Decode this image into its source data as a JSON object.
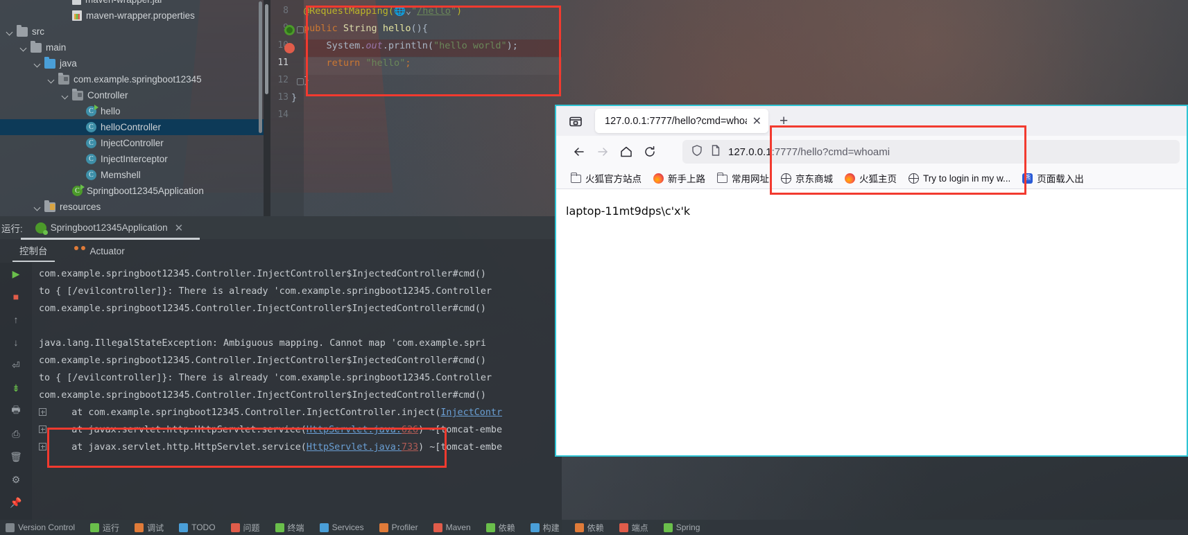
{
  "ide": {
    "project_tree": [
      {
        "label": "maven-wrapper.jar",
        "indent": 4,
        "icon": "jar-icon",
        "chevron": false,
        "selected": false
      },
      {
        "label": "maven-wrapper.properties",
        "indent": 4,
        "icon": "properties-icon",
        "chevron": false,
        "selected": false
      },
      {
        "label": "src",
        "indent": 0,
        "icon": "folder-icon",
        "chevron": true,
        "selected": false
      },
      {
        "label": "main",
        "indent": 1,
        "icon": "folder-icon",
        "chevron": true,
        "selected": false
      },
      {
        "label": "java",
        "indent": 2,
        "icon": "folder-blue-icon",
        "chevron": true,
        "selected": false
      },
      {
        "label": "com.example.springboot12345",
        "indent": 3,
        "icon": "package-icon",
        "chevron": true,
        "selected": false
      },
      {
        "label": "Controller",
        "indent": 4,
        "icon": "package-icon",
        "chevron": true,
        "selected": false
      },
      {
        "label": "hello",
        "indent": 5,
        "icon": "class-runnable-icon",
        "chevron": false,
        "selected": false
      },
      {
        "label": "helloController",
        "indent": 5,
        "icon": "class-icon",
        "chevron": false,
        "selected": true
      },
      {
        "label": "InjectController",
        "indent": 5,
        "icon": "class-icon",
        "chevron": false,
        "selected": false
      },
      {
        "label": "InjectInterceptor",
        "indent": 5,
        "icon": "class-icon",
        "chevron": false,
        "selected": false
      },
      {
        "label": "Memshell",
        "indent": 5,
        "icon": "class-icon",
        "chevron": false,
        "selected": false
      },
      {
        "label": "Springboot12345Application",
        "indent": 4,
        "icon": "spring-class-icon",
        "chevron": false,
        "selected": false
      },
      {
        "label": "resources",
        "indent": 2,
        "icon": "folder-resources-icon",
        "chevron": true,
        "selected": false
      }
    ],
    "editor": {
      "lines": [
        {
          "num": "8",
          "code": "@RequestMapping(\"/hello\")",
          "marker": "",
          "current": false,
          "highlight": false
        },
        {
          "num": "9",
          "code": "public String hello(){",
          "marker": "spring-bean-icon",
          "current": false,
          "highlight": false
        },
        {
          "num": "10",
          "code": "    System.out.println(\"hello world\");",
          "marker": "breakpoint-icon",
          "current": false,
          "highlight": true
        },
        {
          "num": "11",
          "code": "    return \"hello\";",
          "marker": "",
          "current": true,
          "highlight": false
        },
        {
          "num": "12",
          "code": "}",
          "marker": "",
          "current": false,
          "highlight": false
        },
        {
          "num": "13",
          "code": "}",
          "marker": "",
          "current": false,
          "highlight": false
        },
        {
          "num": "14",
          "code": "",
          "marker": "",
          "current": false,
          "highlight": false
        }
      ]
    },
    "run_panel": {
      "run_label": "运行:",
      "config_name": "Springboot12345Application",
      "tabs": [
        {
          "label": "控制台",
          "active": true
        },
        {
          "label": "Actuator",
          "active": false
        }
      ],
      "console_lines": [
        "com.example.springboot12345.Controller.InjectController$InjectedController#cmd()",
        "to { [/evilcontroller]}: There is already 'com.example.springboot12345.Controller",
        "com.example.springboot12345.Controller.InjectController$InjectedController#cmd()",
        "",
        "java.lang.IllegalStateException: Ambiguous mapping. Cannot map 'com.example.spri",
        "com.example.springboot12345.Controller.InjectController$InjectedController#cmd()",
        "to { [/evilcontroller]}: There is already 'com.example.springboot12345.Controller",
        "com.example.springboot12345.Controller.InjectController$InjectedController#cmd()",
        "    at com.example.springboot12345.Controller.InjectController.inject(InjectContr",
        "    at javax.servlet.http.HttpServlet.service(HttpServlet.java:626) ~[tomcat-embe",
        "    at javax.servlet.http.HttpServlet.service(HttpServlet.java:733) ~[tomcat-embe"
      ]
    },
    "bottom_bar": [
      "Version Control",
      "运行",
      "调试",
      "TODO",
      "问题",
      "终端",
      "Services",
      "Profiler",
      "Maven",
      "依赖",
      "构建",
      "依赖",
      "端点",
      "Spring"
    ]
  },
  "browser": {
    "tab": {
      "title": "127.0.0.1:7777/hello?cmd=whoa",
      "close_label": "✕"
    },
    "new_tab_label": "+",
    "url": {
      "host": "127.0.0.1",
      "path": ":7777/hello?cmd=whoami"
    },
    "bookmarks": [
      {
        "label": "火狐官方站点",
        "icon": "folder-icon"
      },
      {
        "label": "新手上路",
        "icon": "firefox-icon"
      },
      {
        "label": "常用网址",
        "icon": "folder-icon"
      },
      {
        "label": "京东商城",
        "icon": "globe-icon"
      },
      {
        "label": "火狐主页",
        "icon": "firefox-icon"
      },
      {
        "label": "Try to login in my w...",
        "icon": "globe-icon"
      },
      {
        "label": "页面载入出",
        "icon": "baidu-icon"
      }
    ],
    "page_content": "laptop-11mt9dps\\c'x'k"
  },
  "colors": {
    "annotation_red": "#f23a2f",
    "browser_accent": "#2ec4d4",
    "tree_selection": "#0d3a58"
  }
}
